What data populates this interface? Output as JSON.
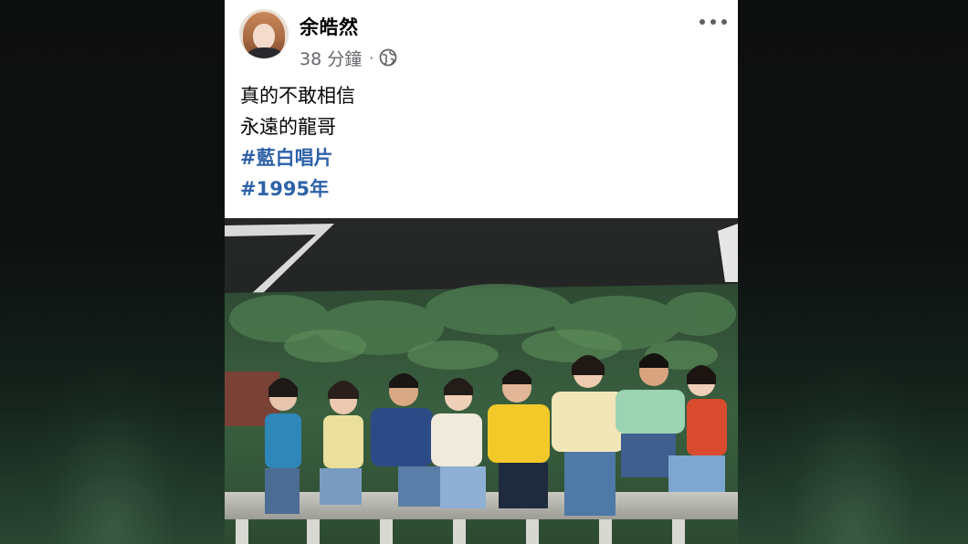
{
  "post": {
    "author": "余皓然",
    "timestamp": "38 分鐘",
    "separator": "·",
    "privacy_icon": "globe-icon",
    "more_icon": "more-options-icon",
    "lines": [
      "真的不敢相信",
      "永遠的龍哥"
    ],
    "hashtags": [
      "#藍白唱片",
      "#1995年"
    ],
    "photo_description_icon": "group-photo"
  },
  "colors": {
    "hashtag": "#2e62a8",
    "meta_text": "#65676b",
    "text": "#050505"
  }
}
